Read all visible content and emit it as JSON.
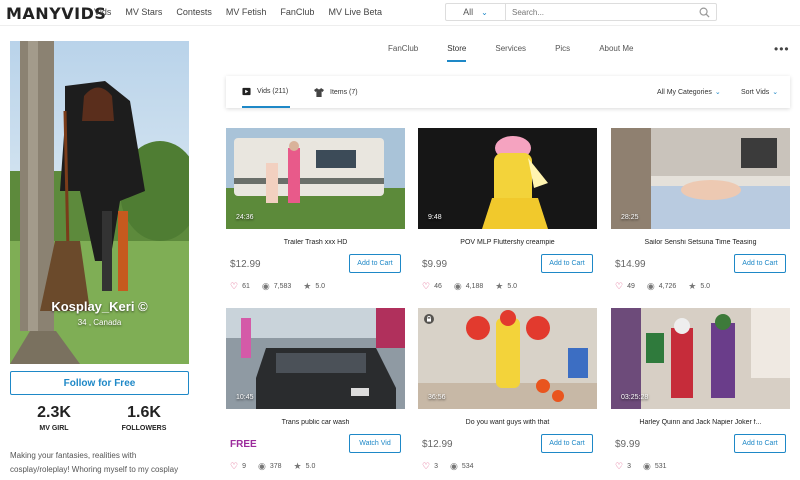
{
  "header": {
    "logo": "MANYVIDS",
    "nav": [
      "Vids",
      "MV Stars",
      "Contests",
      "MV Fetish",
      "FanClub",
      "MV Live Beta"
    ],
    "search": {
      "selected": "All",
      "placeholder": "Search..."
    }
  },
  "profile": {
    "name": "Kosplay_Keri",
    "location": "34 , Canada",
    "follow_label": "Follow for Free",
    "stats": [
      {
        "value": "2.3K",
        "label": "MV GIRL"
      },
      {
        "value": "1.6K",
        "label": "FOLLOWERS"
      }
    ],
    "bio": "Making your fantasies, realities with cosplay/roleplay! Whoring myself to my cosplay fantasies for the..."
  },
  "profile_tabs": [
    "FanClub",
    "Store",
    "Services",
    "Pics",
    "About Me"
  ],
  "active_tab": "Store",
  "store": {
    "tabs": [
      {
        "label": "Vids (211)"
      },
      {
        "label": "Items (7)"
      }
    ],
    "filters": [
      "All My Categories",
      "Sort Vids"
    ]
  },
  "videos": [
    {
      "title": "Trailer Trash xxx HD",
      "duration": "24:36",
      "price": "$12.99",
      "action": "Add to Cart",
      "likes": "61",
      "views": "7,583",
      "rating": "5.0"
    },
    {
      "title": "POV MLP Fluttershy creampie",
      "duration": "9:48",
      "price": "$9.99",
      "action": "Add to Cart",
      "likes": "46",
      "views": "4,188",
      "rating": "5.0"
    },
    {
      "title": "Sailor Senshi Setsuna Time Teasing",
      "duration": "28:25",
      "price": "$14.99",
      "action": "Add to Cart",
      "likes": "49",
      "views": "4,726",
      "rating": "5.0"
    },
    {
      "title": "Trans public car wash",
      "duration": "10:45",
      "price": "FREE",
      "action": "Watch Vid",
      "likes": "9",
      "views": "378",
      "rating": "5.0"
    },
    {
      "title": "Do you want guys with that",
      "duration": "36:56",
      "price": "$12.99",
      "action": "Add to Cart",
      "likes": "3",
      "views": "534",
      "rating": ""
    },
    {
      "title": "Harley Quinn and Jack Napier Joker f...",
      "duration": "03:25:28",
      "price": "$9.99",
      "action": "Add to Cart",
      "likes": "3",
      "views": "531",
      "rating": ""
    }
  ],
  "colors": {
    "accent": "#1e88c7",
    "heart": "#d6336c",
    "free": "#9b2a9b"
  }
}
